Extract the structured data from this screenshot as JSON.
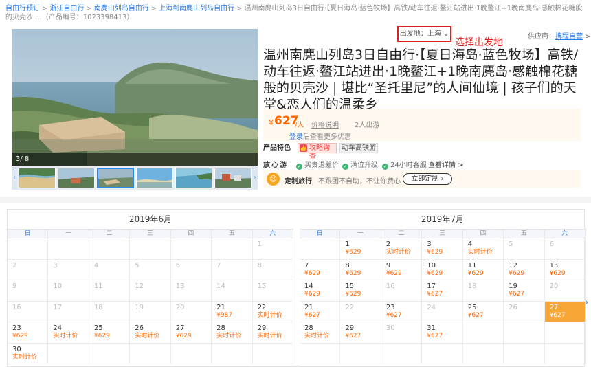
{
  "breadcrumb": {
    "items": [
      "自由行预订",
      "浙江自由行",
      "南麂山列岛自由行",
      "上海到南麂山列岛自由行"
    ],
    "current": "温州南麂山列岛3日自由行·【夏日海岛·蓝色牧场】高铁/动车往返·鳌江站进出·1晚鳌江+1晚南麂岛·感触棉花糖般的贝壳沙 ...（产品编号：1023398413）"
  },
  "gallery": {
    "counter": "3/ 8",
    "left_arrow": "‹",
    "right_arrow": "›"
  },
  "depart": {
    "label": "出发地：上海",
    "note": "选择出发地"
  },
  "supplier": {
    "label": "供应商：",
    "name": "携程自营",
    "arrow": ">"
  },
  "product": {
    "title": "温州南麂山列岛3日自由行·【夏日海岛·蓝色牧场】高铁/动车往返·鳌江站进出·1晚鳌江+1晚南麂岛·感触棉花糖般的贝壳沙 | 堪比“圣托里尼”的人间仙境 | 孩子们的天堂&恋人们的温柔乡",
    "price_currency": "¥",
    "price": "627",
    "price_unit": "/人",
    "price_explain": "价格说明",
    "sold": "2人出游",
    "login_link": "登录",
    "login_text": "后查看更多优惠"
  },
  "features": {
    "label": "产品特色",
    "tag1": "攻略询查",
    "tag2": "动车高铁游"
  },
  "care": {
    "label": "放心游",
    "items": [
      "买贵退差价",
      "满位升级",
      "24小时客服"
    ],
    "more": "查看详情 >"
  },
  "custom": {
    "icon": "☺",
    "label": "定制旅行",
    "desc": "不跟团不自助，不让你费心",
    "button": "立即定制 ›"
  },
  "weekdays": [
    "日",
    "一",
    "二",
    "三",
    "四",
    "五",
    "六"
  ],
  "cal_june": {
    "title": "2019年6月",
    "cells": [
      {
        "d": "",
        "p": ""
      },
      {
        "d": "",
        "p": ""
      },
      {
        "d": "",
        "p": ""
      },
      {
        "d": "",
        "p": ""
      },
      {
        "d": "",
        "p": ""
      },
      {
        "d": "",
        "p": ""
      },
      {
        "d": "1",
        "p": "",
        "past": true
      },
      {
        "d": "2",
        "p": "",
        "past": true
      },
      {
        "d": "3",
        "p": "",
        "past": true
      },
      {
        "d": "4",
        "p": "",
        "past": true
      },
      {
        "d": "5",
        "p": "",
        "past": true
      },
      {
        "d": "6",
        "p": "",
        "past": true
      },
      {
        "d": "7",
        "p": "",
        "past": true
      },
      {
        "d": "8",
        "p": "",
        "past": true
      },
      {
        "d": "9",
        "p": "",
        "past": true
      },
      {
        "d": "10",
        "p": "",
        "past": true
      },
      {
        "d": "11",
        "p": "",
        "past": true
      },
      {
        "d": "12",
        "p": "",
        "past": true
      },
      {
        "d": "13",
        "p": "",
        "past": true
      },
      {
        "d": "14",
        "p": "",
        "past": true
      },
      {
        "d": "15",
        "p": "",
        "past": true
      },
      {
        "d": "16",
        "p": "",
        "past": true
      },
      {
        "d": "17",
        "p": "",
        "past": true
      },
      {
        "d": "18",
        "p": "",
        "past": true
      },
      {
        "d": "19",
        "p": "",
        "past": true
      },
      {
        "d": "20",
        "p": "",
        "past": true
      },
      {
        "d": "21",
        "p": "¥987"
      },
      {
        "d": "22",
        "p": "实时计价"
      },
      {
        "d": "23",
        "p": "¥629"
      },
      {
        "d": "24",
        "p": "实时计价"
      },
      {
        "d": "25",
        "p": "¥629"
      },
      {
        "d": "26",
        "p": "实时计价"
      },
      {
        "d": "27",
        "p": "¥629"
      },
      {
        "d": "28",
        "p": "实时计价"
      },
      {
        "d": "29",
        "p": "实时计价"
      },
      {
        "d": "30",
        "p": "实时计价"
      },
      {
        "d": "",
        "p": ""
      },
      {
        "d": "",
        "p": ""
      },
      {
        "d": "",
        "p": ""
      },
      {
        "d": "",
        "p": ""
      },
      {
        "d": "",
        "p": ""
      },
      {
        "d": "",
        "p": ""
      }
    ]
  },
  "cal_july": {
    "title": "2019年7月",
    "cells": [
      {
        "d": "",
        "p": ""
      },
      {
        "d": "1",
        "p": "¥629"
      },
      {
        "d": "2",
        "p": "实时计价"
      },
      {
        "d": "3",
        "p": "¥629"
      },
      {
        "d": "4",
        "p": "实时计价"
      },
      {
        "d": "5",
        "p": "",
        "past": true
      },
      {
        "d": "6",
        "p": "",
        "past": true
      },
      {
        "d": "7",
        "p": "¥629"
      },
      {
        "d": "8",
        "p": "¥629"
      },
      {
        "d": "9",
        "p": "¥629"
      },
      {
        "d": "10",
        "p": "¥629"
      },
      {
        "d": "11",
        "p": "¥629"
      },
      {
        "d": "12",
        "p": "¥629"
      },
      {
        "d": "13",
        "p": "¥629"
      },
      {
        "d": "14",
        "p": "¥629"
      },
      {
        "d": "15",
        "p": "¥629"
      },
      {
        "d": "16",
        "p": "",
        "past": true
      },
      {
        "d": "17",
        "p": "¥627"
      },
      {
        "d": "18",
        "p": "",
        "past": true
      },
      {
        "d": "19",
        "p": "¥627"
      },
      {
        "d": "20",
        "p": "",
        "past": true
      },
      {
        "d": "21",
        "p": "¥627"
      },
      {
        "d": "22",
        "p": "",
        "past": true
      },
      {
        "d": "23",
        "p": "¥627"
      },
      {
        "d": "24",
        "p": "",
        "past": true
      },
      {
        "d": "25",
        "p": "¥627"
      },
      {
        "d": "26",
        "p": "",
        "past": true
      },
      {
        "d": "27",
        "p": "¥627",
        "sel": true
      },
      {
        "d": "28",
        "p": "实时计价"
      },
      {
        "d": "29",
        "p": "¥627"
      },
      {
        "d": "30",
        "p": "",
        "past": true
      },
      {
        "d": "31",
        "p": "¥627"
      },
      {
        "d": "",
        "p": ""
      },
      {
        "d": "",
        "p": ""
      },
      {
        "d": "",
        "p": ""
      },
      {
        "d": "",
        "p": ""
      },
      {
        "d": "",
        "p": ""
      },
      {
        "d": "",
        "p": ""
      },
      {
        "d": "",
        "p": ""
      },
      {
        "d": "",
        "p": ""
      },
      {
        "d": "",
        "p": ""
      },
      {
        "d": "",
        "p": ""
      }
    ]
  },
  "side_arrow": "›"
}
